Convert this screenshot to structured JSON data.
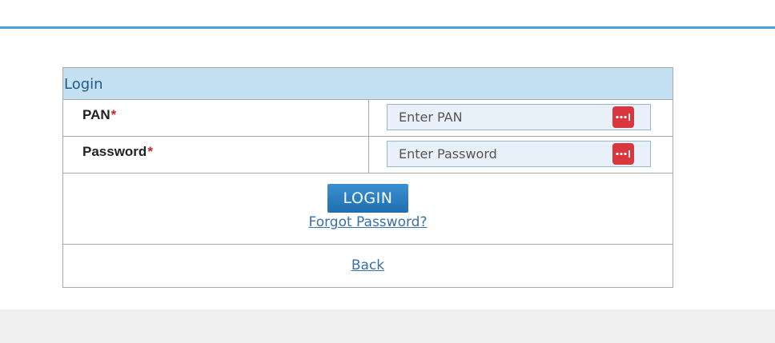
{
  "form": {
    "title": "Login",
    "fields": [
      {
        "label": "PAN",
        "required_mark": "*",
        "placeholder": "Enter PAN",
        "value": ""
      },
      {
        "label": "Password",
        "required_mark": "*",
        "placeholder": "Enter Password",
        "value": ""
      }
    ],
    "login_label": "LOGIN",
    "forgot_label": "Forgot Password?",
    "back_label": "Back"
  },
  "icons": {
    "field_icon": "password-manager-icon"
  },
  "colors": {
    "accent_rule": "#4aa3d6",
    "header_bg": "#c5dff3",
    "button": "#2a7fc2",
    "link": "#3870a8",
    "required": "#cc2222",
    "password_icon": "#d9363e"
  }
}
